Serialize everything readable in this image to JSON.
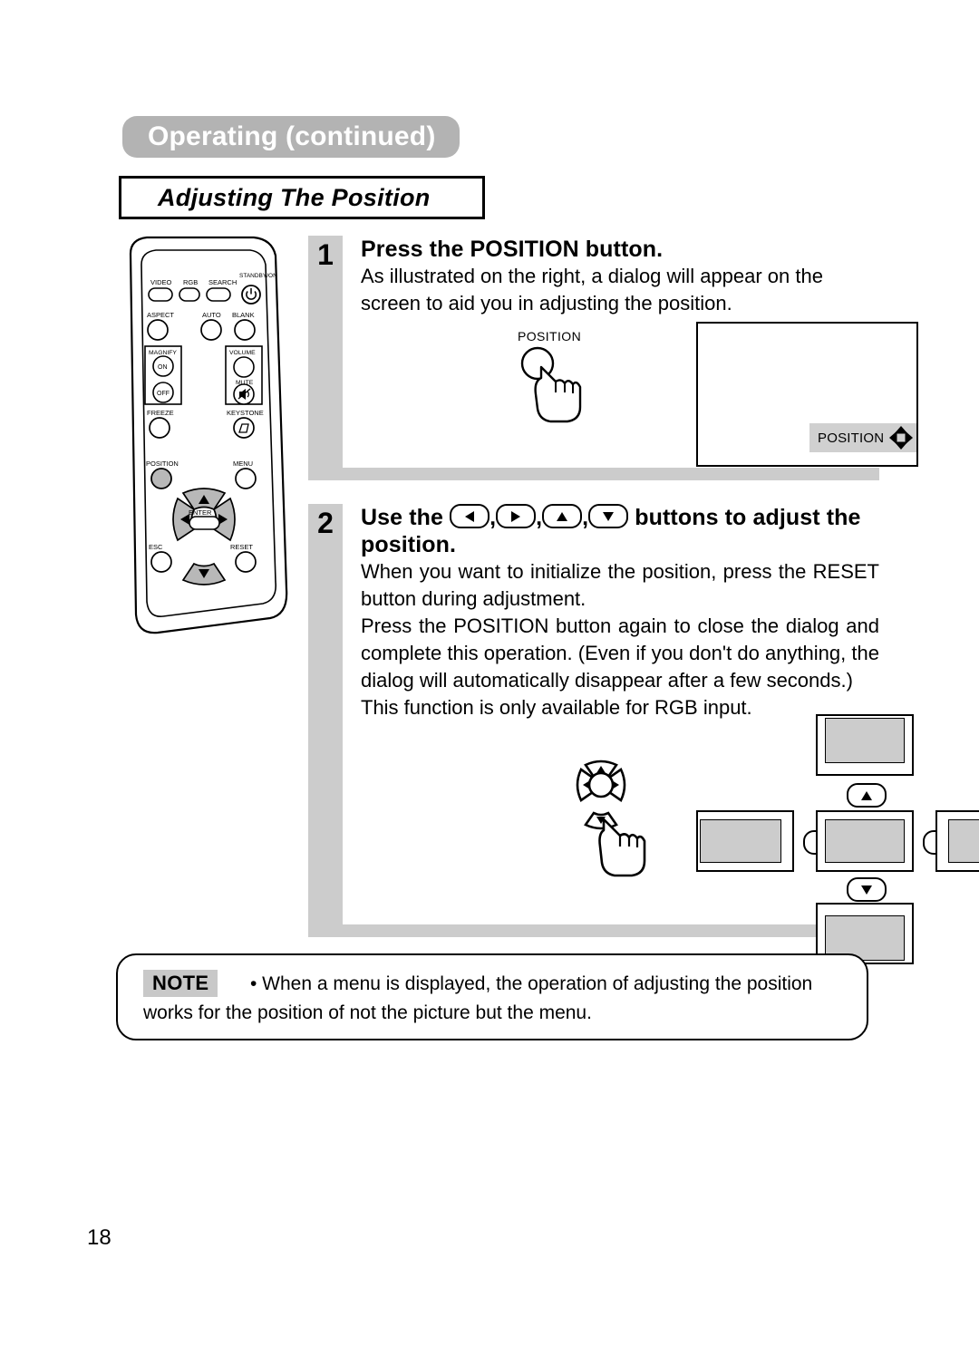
{
  "header": {
    "chapter": "Operating (continued)",
    "section": "Adjusting The Position"
  },
  "remote": {
    "name": "remote-control",
    "buttons": [
      {
        "label": "VIDEO",
        "shape": "rounded"
      },
      {
        "label": "RGB",
        "shape": "rounded"
      },
      {
        "label": "SEARCH",
        "shape": "rounded"
      },
      {
        "label": "STANDBY/ON",
        "shape": "circle",
        "icon": "power-icon"
      },
      {
        "label": "ASPECT",
        "shape": "circle"
      },
      {
        "label": "AUTO",
        "shape": "circle"
      },
      {
        "label": "BLANK",
        "shape": "circle"
      },
      {
        "label": "MAGNIFY",
        "shape": "group"
      },
      {
        "label": "ON",
        "shape": "circle"
      },
      {
        "label": "OFF",
        "shape": "circle"
      },
      {
        "label": "VOLUME",
        "shape": "circle"
      },
      {
        "label": "MUTE",
        "shape": "circle",
        "icon": "mute-icon"
      },
      {
        "label": "FREEZE",
        "shape": "circle"
      },
      {
        "label": "KEYSTONE",
        "shape": "circle",
        "icon": "keystone-icon"
      },
      {
        "label": "POSITION",
        "shape": "circle",
        "highlighted": true
      },
      {
        "label": "MENU",
        "shape": "circle"
      },
      {
        "label": "ENTER",
        "shape": "oval"
      },
      {
        "label": "ESC",
        "shape": "circle"
      },
      {
        "label": "RESET",
        "shape": "circle"
      }
    ],
    "labels": {
      "video": "VIDEO",
      "rgb": "RGB",
      "search": "SEARCH",
      "standby_on": "STANDBY/ON",
      "aspect": "ASPECT",
      "auto": "AUTO",
      "blank": "BLANK",
      "magnify": "MAGNIFY",
      "on": "ON",
      "off": "OFF",
      "volume": "VOLUME",
      "mute": "MUTE",
      "freeze": "FREEZE",
      "keystone": "KEYSTONE",
      "position": "POSITION",
      "menu": "MENU",
      "enter": "ENTER",
      "esc": "ESC",
      "reset": "RESET"
    }
  },
  "steps": [
    {
      "number": "1",
      "heading": "Press the POSITION button.",
      "paragraphs": [
        "As illustrated on the right, a dialog will appear on the screen to aid you in adjusting the position."
      ]
    },
    {
      "number": "2",
      "heading_before": "Use the",
      "heading_after": "buttons to adjust the position.",
      "heading_icons": [
        "left-arrow-button",
        "right-arrow-button",
        "up-arrow-button",
        "down-arrow-button"
      ],
      "number2": "2",
      "paragraphs": [
        "When you want to initialize the position, press the RESET button during adjustment.",
        "Press the POSITION button again to close the dialog and complete this operation.  (Even if you don't do anything, the dialog will automatically disappear after a few seconds.)",
        "This function is only available for RGB input."
      ]
    }
  ],
  "figure_dialog": {
    "button_caption": "POSITION",
    "osd_label": "POSITION"
  },
  "note": {
    "tag": "NOTE",
    "text": "• When a menu is displayed, the operation of adjusting the position works for the position of not the picture but the menu."
  },
  "footer": {
    "page_number": "18"
  },
  "colors": {
    "chapter_pill": "#b3b3b3",
    "step_bar": "#cccccc",
    "osd_badge": "#d0d0d0",
    "note_tag": "#c8c8c8",
    "thumb_fill": "#cccccc"
  }
}
